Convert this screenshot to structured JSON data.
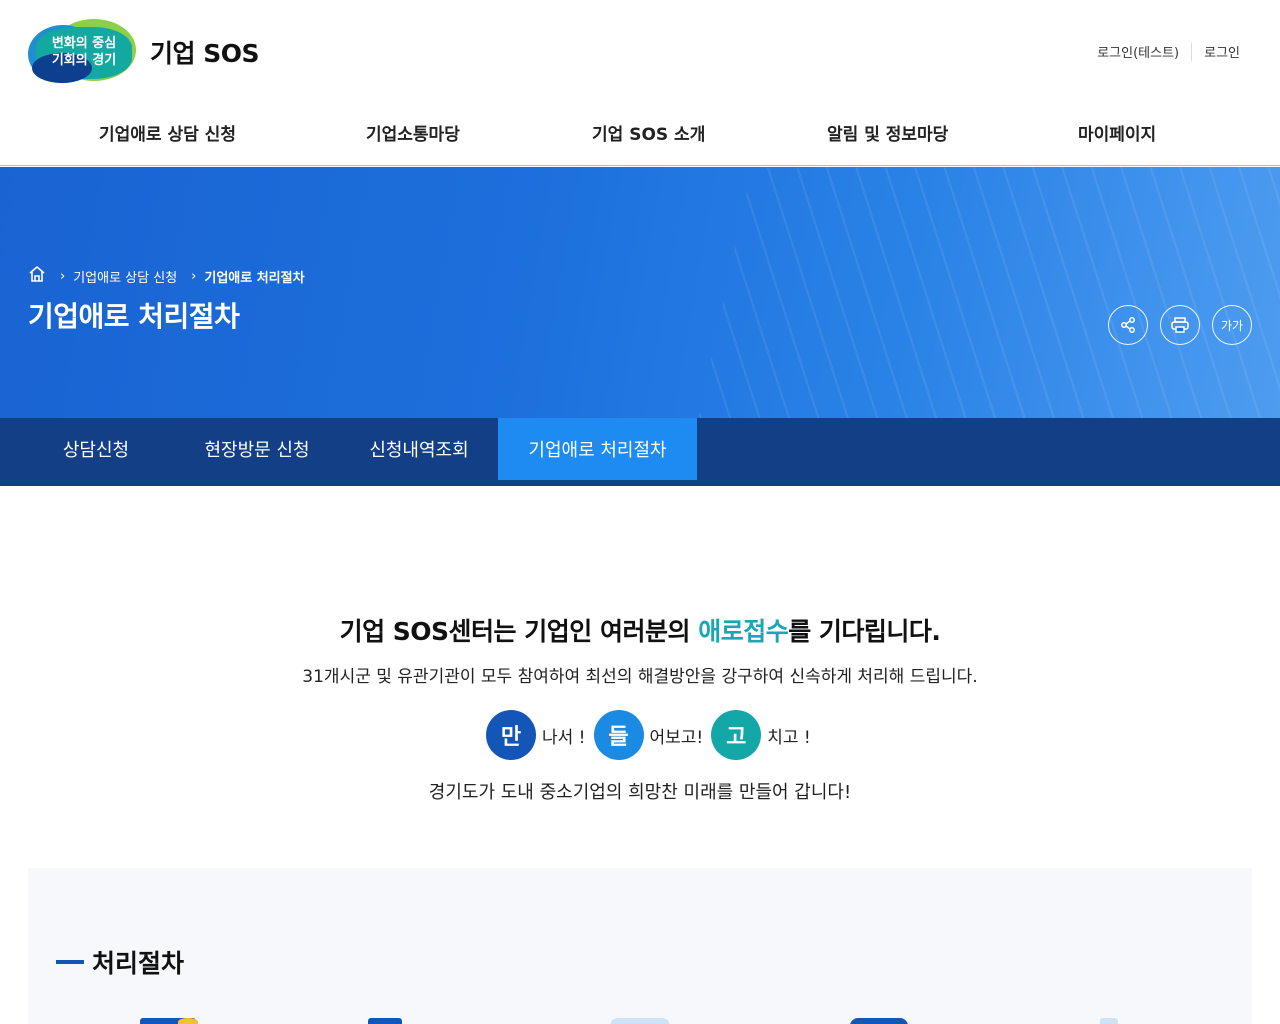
{
  "header": {
    "logo_text": "변화의 중심\n기회의 경기",
    "site_name": "기업 SOS",
    "util_links": [
      "로그인(테스트)",
      "로그인"
    ]
  },
  "gnb": [
    "기업애로 상담 신청",
    "기업소통마당",
    "기업 SOS 소개",
    "알림 및 정보마당",
    "마이페이지"
  ],
  "visual": {
    "breadcrumb": [
      "기업애로 상담 신청",
      "기업애로 처리절차"
    ],
    "title": "기업애로 처리절차",
    "tools": {
      "share": "share-icon",
      "print": "print-icon",
      "font": "가가"
    }
  },
  "subtabs": [
    "상담신청",
    "현장방문 신청",
    "신청내역조회",
    "기업애로 처리절차"
  ],
  "subtabs_active": 3,
  "intro": {
    "headline_pre": "기업 SOS센터는 기업인 여러분의 ",
    "headline_hl": "애로접수",
    "headline_post": "를 기다립니다.",
    "sub": "31개시군 및 유관기관이 모두 참여하여 최선의 해결방안을 강구하여 신속하게 처리해 드립니다.",
    "mdg": [
      {
        "char": "만",
        "text": "나서 !"
      },
      {
        "char": "들",
        "text": "어보고!"
      },
      {
        "char": "고",
        "text": "치고 !"
      }
    ],
    "closing": "경기도가 도내 중소기업의 희망찬 미래를 만들어 갑니다!"
  },
  "process": {
    "title": "처리절차"
  },
  "colors": {
    "brand_dark": "#123f86",
    "brand_active": "#1e8bf2",
    "highlight": "#1aa6b4"
  }
}
